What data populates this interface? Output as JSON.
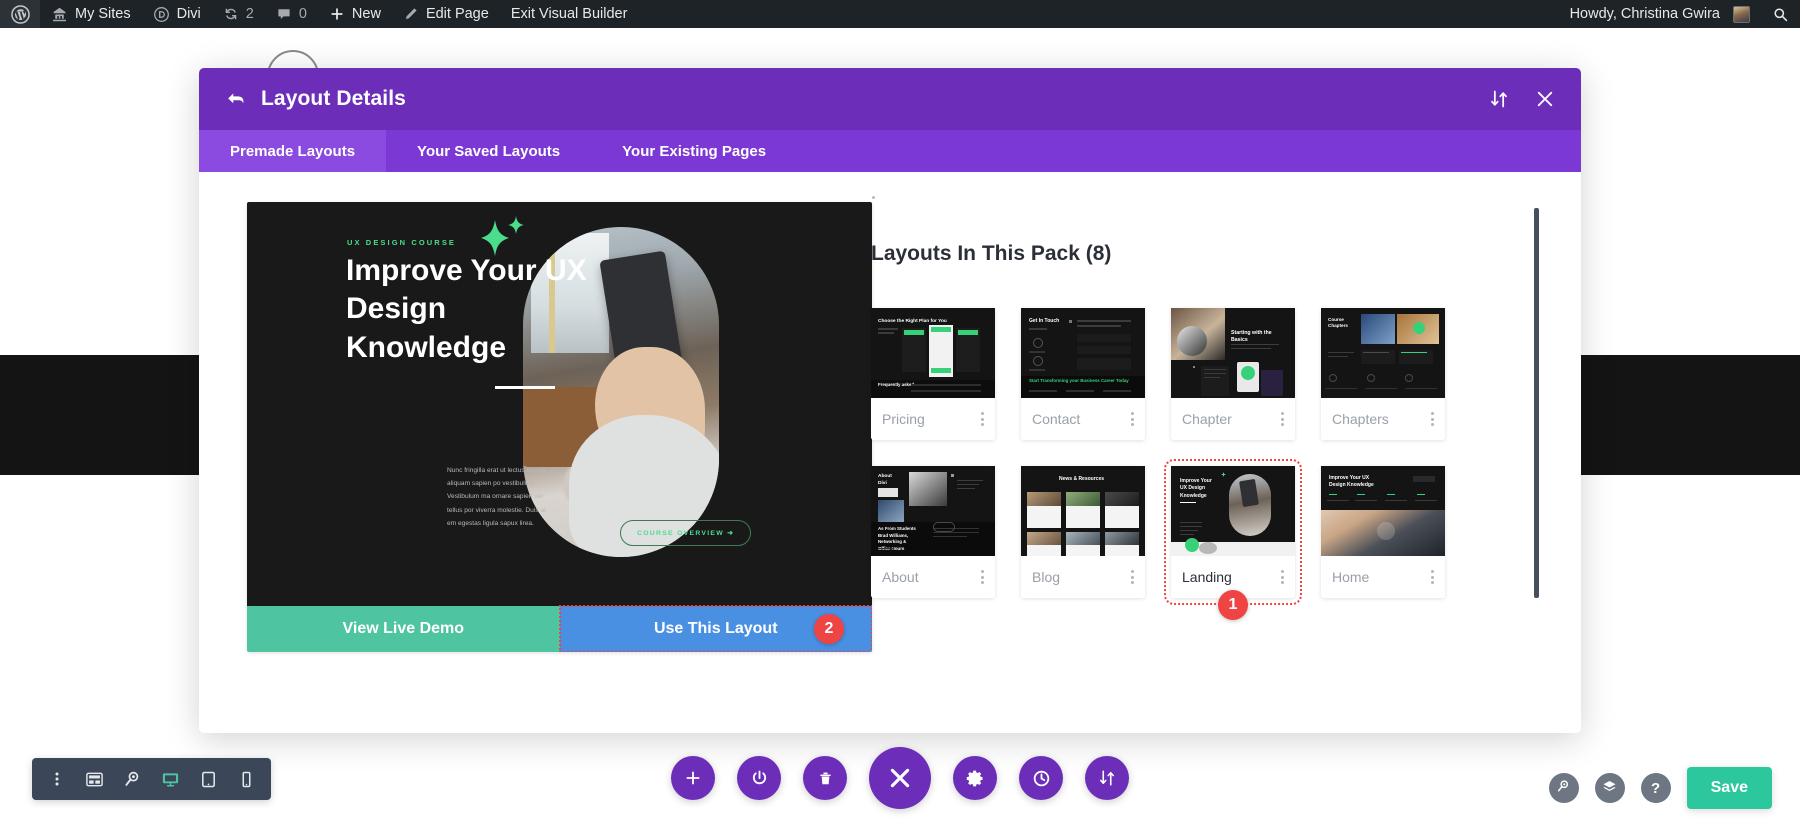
{
  "adminbar": {
    "left_items": [
      {
        "id": "wp-logo",
        "icon": "wordpress-icon",
        "label": ""
      },
      {
        "id": "my-sites",
        "icon": "sites-icon",
        "label": "My Sites"
      },
      {
        "id": "divi",
        "icon": "divi-icon",
        "label": "Divi"
      },
      {
        "id": "updates",
        "icon": "updates-icon",
        "label": "2"
      },
      {
        "id": "comments",
        "icon": "comment-icon",
        "label": "0"
      },
      {
        "id": "new",
        "icon": "plus-icon",
        "label": "New"
      },
      {
        "id": "edit-page",
        "icon": "pencil-icon",
        "label": "Edit Page"
      },
      {
        "id": "exit-visual-builder",
        "icon": "",
        "label": "Exit Visual Builder"
      }
    ],
    "howdy": "Howdy, Christina Gwira",
    "search_icon": "search-icon"
  },
  "modal": {
    "title": "Layout Details",
    "back_icon": "back-arrow-icon",
    "sort_icon": "sort-updown-icon",
    "close_icon": "close-icon",
    "tabs": [
      {
        "label": "Premade Layouts",
        "active": true
      },
      {
        "label": "Your Saved Layouts",
        "active": false
      },
      {
        "label": "Your Existing Pages",
        "active": false
      }
    ]
  },
  "preview": {
    "kicker": "UX DESIGN COURSE",
    "heading": "Improve Your UX Design Knowledge",
    "body": "Nunc fringilla erat ut lectus aliquet, a aliquam sapien po vestibulum. Vestibulum ma ornare sapien vel tellus por viverra molestie. Duis at em egestas ligula sapux lirea.",
    "cta": "COURSE OVERVIEW ➜",
    "demo_button": "View Live Demo",
    "use_button": "Use This Layout",
    "use_badge": "2"
  },
  "pack": {
    "title": "Layouts In This Pack (8)",
    "selected_badge": "1",
    "layouts": [
      {
        "name": "Pricing",
        "selected": false,
        "thumb_title": "Choose the Right Plan for You"
      },
      {
        "name": "Contact",
        "selected": false,
        "thumb_title": "Get In Touch"
      },
      {
        "name": "Chapter",
        "selected": false,
        "thumb_title": "Starting with the Basics"
      },
      {
        "name": "Chapters",
        "selected": false,
        "thumb_title": "Course Chapters"
      },
      {
        "name": "About",
        "selected": false,
        "thumb_title": "About Divi"
      },
      {
        "name": "Blog",
        "selected": false,
        "thumb_title": "News & Resources"
      },
      {
        "name": "Landing",
        "selected": true,
        "thumb_title": "Improve Your UX Design Knowledge"
      },
      {
        "name": "Home",
        "selected": false,
        "thumb_title": "Improve Your UX Design Knowledge"
      }
    ]
  },
  "toolbar_left": {
    "items": [
      {
        "id": "more",
        "icon": "kebab-menu-icon",
        "active": false
      },
      {
        "id": "wireframe",
        "icon": "wireframe-icon",
        "active": false
      },
      {
        "id": "zoom",
        "icon": "magnifier-icon",
        "active": false
      },
      {
        "id": "desktop",
        "icon": "desktop-icon",
        "active": true
      },
      {
        "id": "tablet",
        "icon": "tablet-icon",
        "active": false
      },
      {
        "id": "phone",
        "icon": "phone-icon",
        "active": false
      }
    ],
    "active_color": "#4fc4a0"
  },
  "toolbar_center": {
    "items": [
      {
        "id": "add",
        "icon": "plus-icon",
        "big": false
      },
      {
        "id": "power",
        "icon": "power-icon",
        "big": false
      },
      {
        "id": "trash",
        "icon": "trash-icon",
        "big": false
      },
      {
        "id": "close",
        "icon": "close-x-icon",
        "big": true
      },
      {
        "id": "settings",
        "icon": "gear-icon",
        "big": false
      },
      {
        "id": "history",
        "icon": "clock-icon",
        "big": false
      },
      {
        "id": "sort",
        "icon": "sort-updown-icon",
        "big": false
      }
    ],
    "color": "#6c2eb9"
  },
  "toolbar_right": {
    "items": [
      {
        "id": "search",
        "icon": "magnifier-icon"
      },
      {
        "id": "layers",
        "icon": "layers-icon"
      },
      {
        "id": "help",
        "icon": "question-icon"
      }
    ],
    "save_label": "Save",
    "save_color": "#2cc79c"
  }
}
